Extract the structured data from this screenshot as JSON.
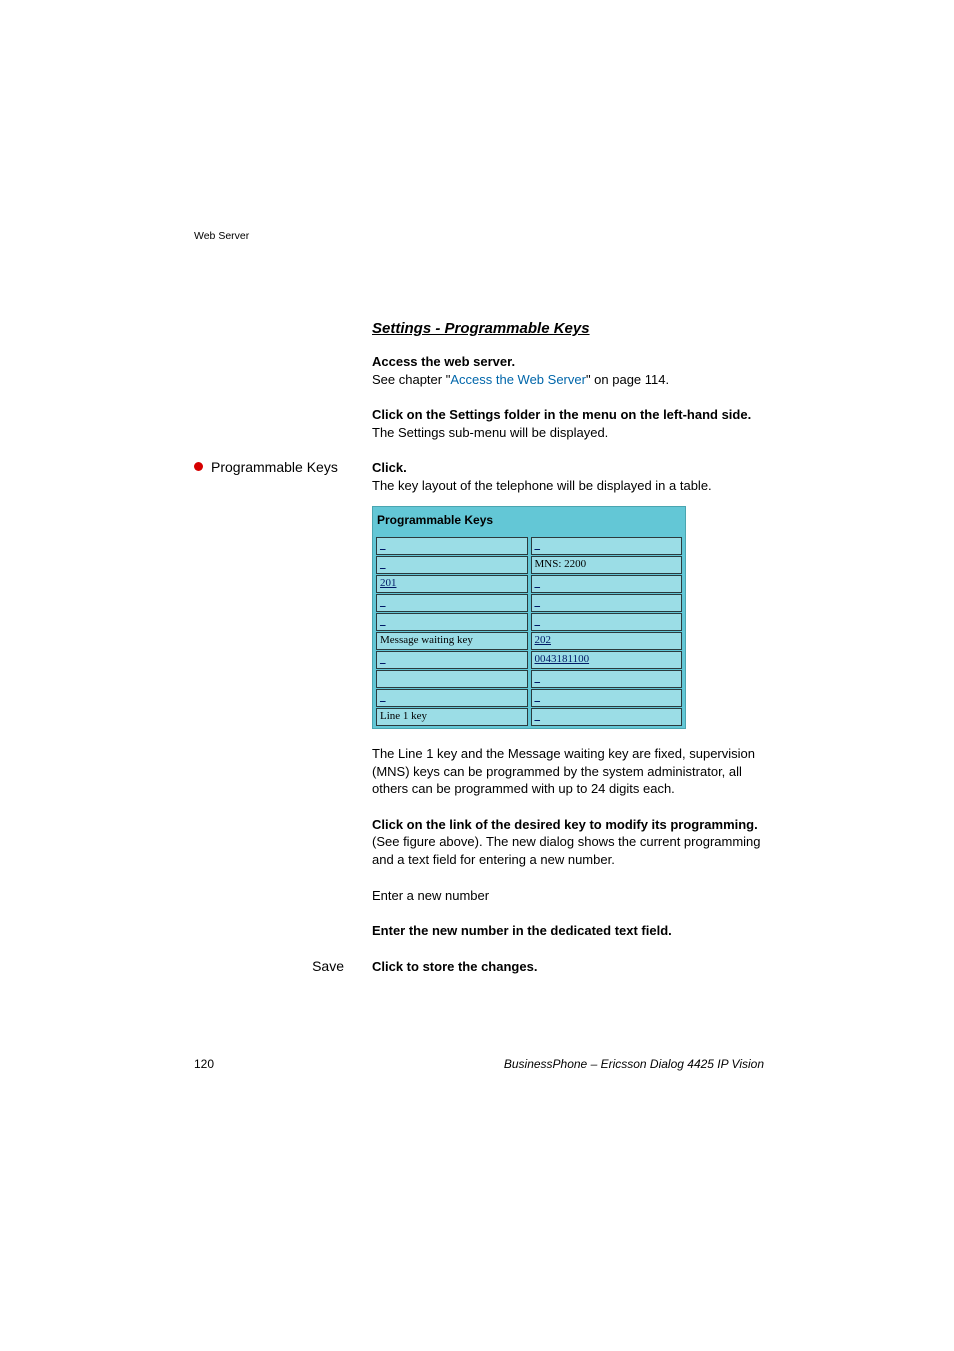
{
  "header": {
    "label": "Web Server"
  },
  "section": {
    "title": "Settings - Programmable Keys"
  },
  "step1": {
    "bold": "Access the web server.",
    "pre": "See chapter \"",
    "link": "Access the Web Server",
    "post": "\" on page 114."
  },
  "step2": {
    "bold": "Click on the Settings folder in the menu on the left-hand side.",
    "plain": "The Settings sub-menu will be displayed."
  },
  "step3": {
    "left": "Programmable Keys",
    "bold": "Click.",
    "plain": "The key layout of the telephone will be displayed in a table."
  },
  "figure": {
    "title": "Programmable Keys",
    "rows": [
      [
        "_",
        "_"
      ],
      [
        "_",
        "MNS: 2200"
      ],
      [
        "201",
        "_"
      ],
      [
        "_",
        "_"
      ],
      [
        "_",
        "_"
      ],
      [
        "Message waiting key",
        "202"
      ],
      [
        "_",
        "0043181100"
      ],
      [
        "",
        "_"
      ],
      [
        "_",
        "_"
      ],
      [
        "Line 1 key",
        "_"
      ]
    ]
  },
  "para_after_figure": "The Line 1 key and the Message waiting key are fixed, supervision (MNS) keys can be programmed by the system administrator, all others can be programmed with up to 24 digits each.",
  "step4": {
    "bold": "Click on the link of the desired key to modify its programming.",
    "plain": "(See figure above). The new dialog shows the current programming and a text field for entering a new number."
  },
  "enter_label": "Enter a new number",
  "step5": {
    "bold": "Enter the new number in the dedicated text field."
  },
  "step6": {
    "left": "Save",
    "bold": "Click to store the changes."
  },
  "footer": {
    "page_number": "120",
    "product": "BusinessPhone – Ericsson Dialog 4425 IP Vision"
  }
}
